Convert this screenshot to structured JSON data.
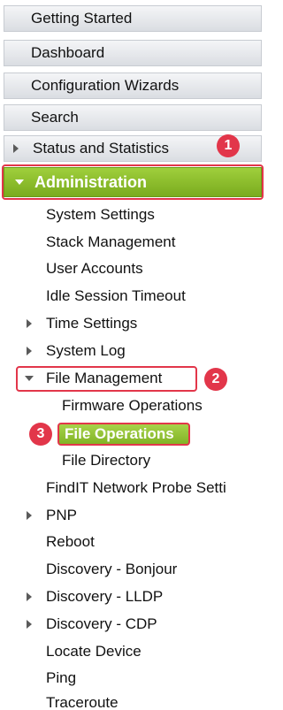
{
  "sidebar": {
    "top_items": [
      {
        "label": "Getting Started"
      },
      {
        "label": "Dashboard"
      },
      {
        "label": "Configuration Wizards"
      },
      {
        "label": "Search"
      },
      {
        "label": "Status and Statistics"
      }
    ],
    "active_section": {
      "label": "Administration"
    },
    "admin_items": [
      {
        "label": "System Settings"
      },
      {
        "label": "Stack Management"
      },
      {
        "label": "User Accounts"
      },
      {
        "label": "Idle Session Timeout"
      },
      {
        "label": "Time Settings"
      },
      {
        "label": "System Log"
      },
      {
        "label": "File Management"
      },
      {
        "label": "FindIT Network Probe Setti"
      },
      {
        "label": "PNP"
      },
      {
        "label": "Reboot"
      },
      {
        "label": "Discovery - Bonjour"
      },
      {
        "label": "Discovery - LLDP"
      },
      {
        "label": "Discovery - CDP"
      },
      {
        "label": "Locate Device"
      },
      {
        "label": "Ping"
      },
      {
        "label": "Traceroute"
      }
    ],
    "file_management_items": [
      {
        "label": "Firmware Operations"
      },
      {
        "label": "File Operations"
      },
      {
        "label": "File Directory"
      }
    ]
  },
  "annotations": {
    "step1": "1",
    "step2": "2",
    "step3": "3"
  },
  "colors": {
    "accent_green": "#8dc02e",
    "annotation_red": "#e2364a"
  }
}
